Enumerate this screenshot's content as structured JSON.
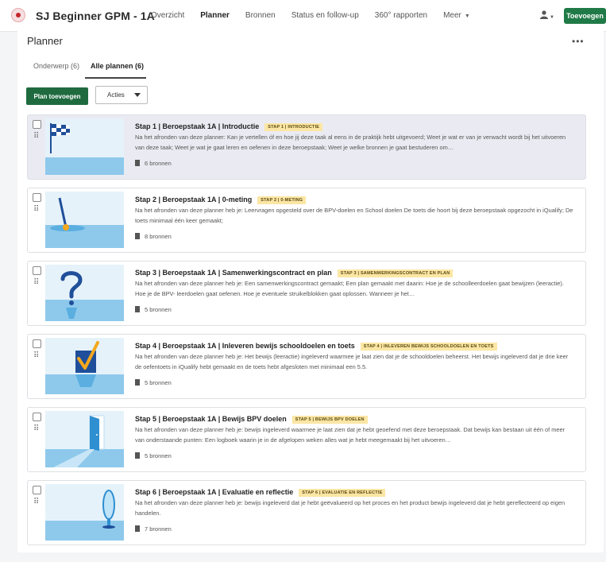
{
  "header": {
    "course_title": "SJ Beginner GPM - 1A",
    "nav": [
      "Overzicht",
      "Planner",
      "Bronnen",
      "Status en follow-up",
      "360° rapporten",
      "Meer"
    ],
    "add_button": "Toevoegen",
    "user_icon": "user-icon"
  },
  "page": {
    "title": "Planner",
    "more_label": "•••",
    "tabs": [
      "Onderwerp (6)",
      "Alle plannen (6)"
    ],
    "plan_button": "Plan toevoegen",
    "actions_button": "Acties"
  },
  "plans": [
    {
      "title": "Stap 1 | Beroepstaak 1A | Introductie",
      "tag": "STAP 1 | INTRODUCTIE",
      "description": "Na het afronden van deze planner: Kan je vertellen óf en hoe jij deze taak al eens in de praktijk hebt uitgevoerd; Weet je wat er van je verwacht wordt bij het uitvoeren van deze taak; Weet je wat je gaat leren en oefenen in deze beroepstaak; Weet je welke bronnen je gaat bestuderen om…",
      "resources": "6 bronnen",
      "image": "checkered-flag"
    },
    {
      "title": "Stap 2 | Beroepstaak 1A | 0-meting",
      "tag": "STAP 2 | 0-METING",
      "description": "Na het afronden van deze planner heb je: Leervragen opgesteld over de BPV-doelen en School doelen De toets die hoort bij deze beroepstaak opgezocht in iQualify; De toets minimaal één keer gemaakt;",
      "resources": "8 bronnen",
      "image": "gauge-needle"
    },
    {
      "title": "Stap 3 | Beroepstaak 1A | Samenwerkingscontract en plan",
      "tag": "STAP 3 | SAMENWERKINGSCONTRACT EN PLAN",
      "description": "Na het afronden van deze planner heb je: Een samenwerkingscontract gemaakt; Een plan gemaakt met daarin: Hoe je de schoolleerdoelen gaat bewijzen (leeractie). Hoe je de BPV- leerdoelen gaat oefenen. Hoe je eventuele struikelblokken gaat oplossen. Wanneer je het…",
      "resources": "5 bronnen",
      "image": "question-mark"
    },
    {
      "title": "Stap 4 | Beroepstaak 1A | Inleveren bewijs schooldoelen en toets",
      "tag": "STAP 4 | INLEVEREN BEWIJS SCHOOLDOELEN EN TOETS",
      "description": "Na het afronden van deze planner heb je: Het bewijs (leeractie) ingeleverd waarmee je laat zien dat je de schooldoelen beheerst. Het bewijs ingeleverd dat je drie keer de oefentoets in iQualify hebt gemaakt en de toets hebt afgesloten met minimaal een 5.5.",
      "resources": "5 bronnen",
      "image": "checkmark-box"
    },
    {
      "title": "Stap 5 | Beroepstaak 1A | Bewijs BPV doelen",
      "tag": "STAP 5 | BEWIJS BPV DOELEN",
      "description": "Na het afronden van deze planner heb je: bewijs ingeleverd waarmee je laat zien dat je hebt geoefend met deze beroepstaak. Dat bewijs kan bestaan uit één of meer van onderstaande punten: Een logboek waarin je in de afgelopen weken alles wat je hebt meegemaakt bij het uitvoeren…",
      "resources": "5 bronnen",
      "image": "open-door"
    },
    {
      "title": "Stap 6 | Beroepstaak 1A | Evaluatie en reflectie",
      "tag": "STAP 6 | EVALUATIE EN REFLECTIE",
      "description": "Na het afronden van deze planner heb je: bewijs ingeleverd dat je hebt geëvalueerd op het proces en het product bewijs ingeleverd dat je hebt gereflecteerd op eigen handelen.",
      "resources": "7 bronnen",
      "image": "mirror"
    }
  ],
  "colors": {
    "primary_green": "#1f6b3f",
    "tag_yellow": "#fbe6a4",
    "illustration_blue": "#2f8fd1",
    "highlight_card": "#eaebf2"
  }
}
